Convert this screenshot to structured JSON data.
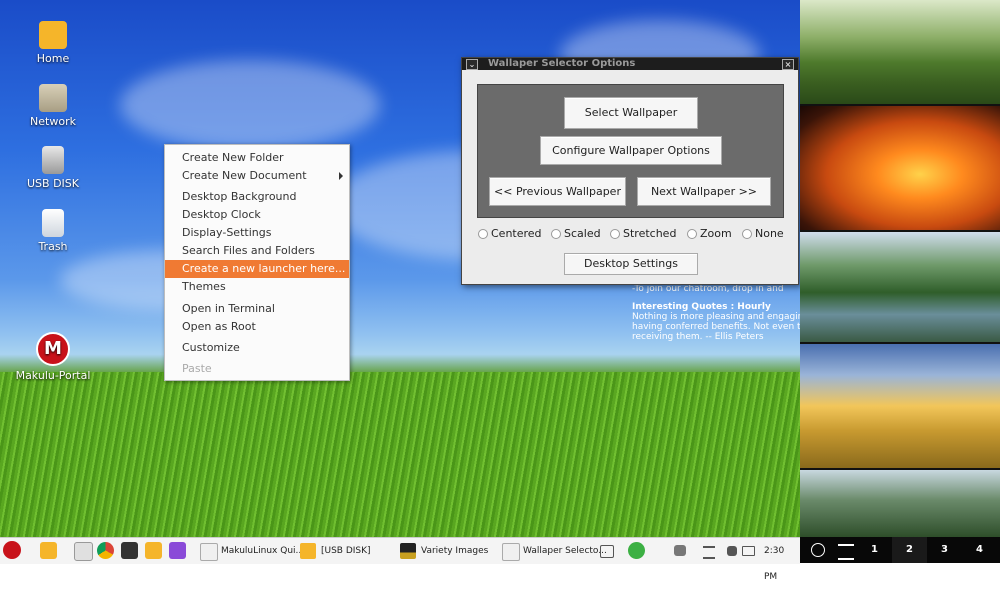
{
  "desktop_icons": [
    {
      "label": "Home",
      "icon": "home-folder-icon"
    },
    {
      "label": "Network",
      "icon": "network-icon"
    },
    {
      "label": "USB DISK",
      "icon": "usb-disk-icon"
    },
    {
      "label": "Trash",
      "icon": "trash-icon"
    },
    {
      "label": "Makulu-Portal",
      "icon": "makulu-logo-icon",
      "glyph": "M"
    }
  ],
  "context_menu": {
    "items": [
      {
        "label": "Create New Folder"
      },
      {
        "label": "Create New Document",
        "submenu": true
      },
      {
        "label": "Desktop Background"
      },
      {
        "label": "Desktop Clock"
      },
      {
        "label": "Display-Settings"
      },
      {
        "label": "Search Files and Folders"
      },
      {
        "label": "Create a new launcher here...",
        "highlighted": true
      },
      {
        "label": "Themes"
      },
      {
        "label": "Open in Terminal"
      },
      {
        "label": "Open as Root"
      },
      {
        "label": "Customize"
      },
      {
        "label": "Paste",
        "disabled": true
      }
    ]
  },
  "dialog": {
    "title": "Wallaper Selector Options",
    "select_wallpaper": "Select Wallpaper",
    "configure": "Configure Wallpaper Options",
    "previous": "<< Previous Wallpaper",
    "next": "Next Wallpaper >>",
    "modes": [
      "Centered",
      "Scaled",
      "Stretched",
      "Zoom",
      "None"
    ],
    "desktop_settings": "Desktop Settings"
  },
  "desktop_text": {
    "chat_line": "-To join our chatroom, drop in and",
    "quote_title": "Interesting Quotes : Hourly",
    "quote_lines": [
      "Nothing is more pleasing and engaging t",
      "having conferred benefits. Not even the",
      "receiving them.  -- Ellis Peters"
    ]
  },
  "taskbar": {
    "tasks": [
      {
        "label": "MakuluLinux Qui...",
        "icon": "document-icon"
      },
      {
        "label": "[USB DISK]",
        "icon": "folder-icon"
      },
      {
        "label": "Variety Images",
        "icon": "image-viewer-icon"
      },
      {
        "label": "Wallaper Selecto...",
        "icon": "document-icon"
      }
    ],
    "clock": "2:30 PM"
  },
  "workspaces": [
    "1",
    "2",
    "3",
    "4"
  ],
  "active_workspace": "2",
  "colors": {
    "menu_highlight": "#f07a33",
    "taskbar_bg": "#f4f4f4",
    "dialog_titlebar": "#1d1d1d"
  }
}
